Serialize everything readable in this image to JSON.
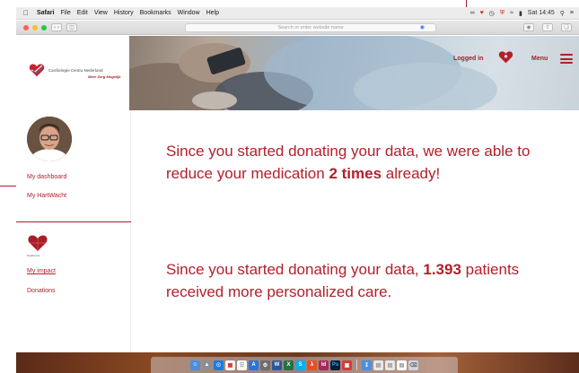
{
  "menubar": {
    "apple_icon": "apple-icon",
    "app_name": "Safari",
    "menus": [
      "File",
      "Edit",
      "View",
      "History",
      "Bookmarks",
      "Window",
      "Help"
    ],
    "clock": "Sat 14:45"
  },
  "browser": {
    "address_placeholder": "Search or enter website name"
  },
  "header": {
    "logo_title": "Cardiologie Centra Nederland",
    "logo_subtitle": "Meer Zorg Mogelijk",
    "logged_in_label": "Logged in",
    "menu_label": "Menu"
  },
  "sidebar": {
    "nav_top": [
      "My dashboard",
      "My HartWacht"
    ],
    "datadonor_label": "DataDonor",
    "nav_bottom": [
      "My impact",
      "Donations"
    ]
  },
  "main": {
    "message1": {
      "before": "Since you started donating your data, we were able to reduce your medication ",
      "count": "2 times",
      "after": " already!"
    },
    "message2": {
      "before": "Since you started donating your data, ",
      "count": "1.393",
      "after": " patients received more personalized care."
    }
  },
  "colors": {
    "brand_red": "#b3202b",
    "accent_dark_red": "#a51f2a"
  }
}
